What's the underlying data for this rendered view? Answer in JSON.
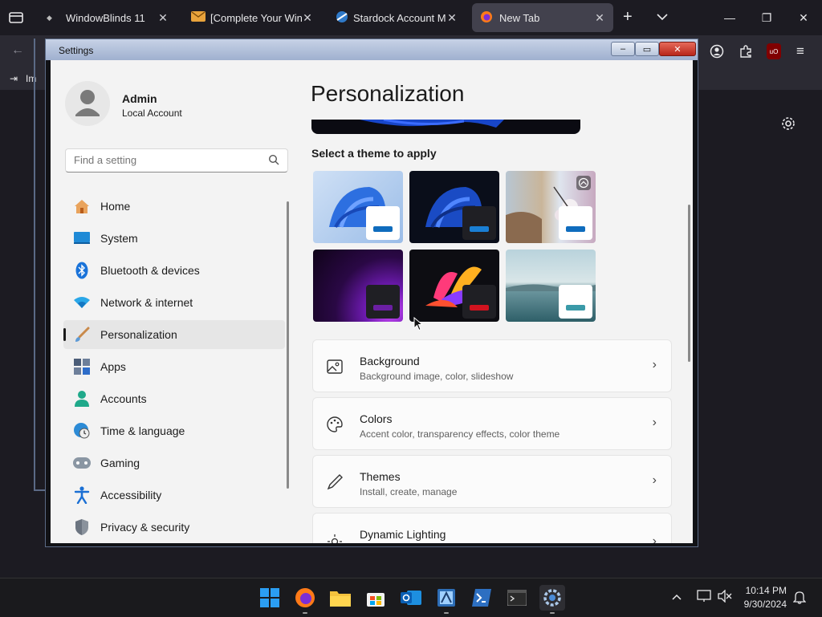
{
  "browser": {
    "tabs": [
      {
        "label": "WindowBlinds 11",
        "icon": "windowblinds-icon"
      },
      {
        "label": "[Complete Your Windo",
        "icon": "mail-icon"
      },
      {
        "label": "Stardock Account Man",
        "icon": "stardock-icon"
      },
      {
        "label": "New Tab",
        "icon": "firefox-icon"
      }
    ],
    "bookmark_fragment": "Im",
    "ublock_badge": "uO"
  },
  "settings": {
    "window_title": "Settings",
    "user": {
      "name": "Admin",
      "account_type": "Local Account"
    },
    "search": {
      "placeholder": "Find a setting"
    },
    "nav": [
      {
        "label": "Home",
        "icon": "home-icon",
        "color": "#d9883b"
      },
      {
        "label": "System",
        "icon": "system-icon",
        "color": "#1f8ad6"
      },
      {
        "label": "Bluetooth & devices",
        "icon": "bluetooth-icon",
        "color": "#1a73d9"
      },
      {
        "label": "Network & internet",
        "icon": "wifi-icon",
        "color": "#2aa7e8"
      },
      {
        "label": "Personalization",
        "icon": "brush-icon",
        "color": "#c76a2f",
        "selected": true
      },
      {
        "label": "Apps",
        "icon": "apps-icon",
        "color": "#4b5d78"
      },
      {
        "label": "Accounts",
        "icon": "accounts-icon",
        "color": "#1fa98a"
      },
      {
        "label": "Time & language",
        "icon": "globe-clock-icon",
        "color": "#2c8bd6"
      },
      {
        "label": "Gaming",
        "icon": "controller-icon",
        "color": "#7b8794"
      },
      {
        "label": "Accessibility",
        "icon": "accessibility-icon",
        "color": "#1a6fd4"
      },
      {
        "label": "Privacy & security",
        "icon": "shield-icon",
        "color": "#6b7480"
      }
    ],
    "page_title": "Personalization",
    "theme_section_label": "Select a theme to apply",
    "themes": [
      {
        "name": "light-bloom",
        "bar_color": "#0f6cbd"
      },
      {
        "name": "dark-bloom",
        "bar_color": "#1a7fd4"
      },
      {
        "name": "spotlight-flowers",
        "bar_color": "#0f6cbd",
        "selected": true
      },
      {
        "name": "glow-purple",
        "bar_color": "#6b1fa3"
      },
      {
        "name": "captured-motion",
        "bar_color": "#d1131f"
      },
      {
        "name": "sunrise-lake",
        "bar_color": "#3a9aa8"
      }
    ],
    "cards": [
      {
        "title": "Background",
        "subtitle": "Background image, color, slideshow",
        "icon": "image-icon"
      },
      {
        "title": "Colors",
        "subtitle": "Accent color, transparency effects, color theme",
        "icon": "palette-icon"
      },
      {
        "title": "Themes",
        "subtitle": "Install, create, manage",
        "icon": "pen-icon"
      },
      {
        "title": "Dynamic Lighting",
        "subtitle": "",
        "icon": "lighting-icon"
      }
    ]
  },
  "taskbar": {
    "time": "10:14 PM",
    "date": "9/30/2024",
    "apps": [
      "start-icon",
      "firefox-icon",
      "file-explorer-icon",
      "store-icon",
      "outlook-icon",
      "windowblinds-app-icon",
      "powershell-icon",
      "terminal-icon",
      "settings-icon"
    ]
  }
}
